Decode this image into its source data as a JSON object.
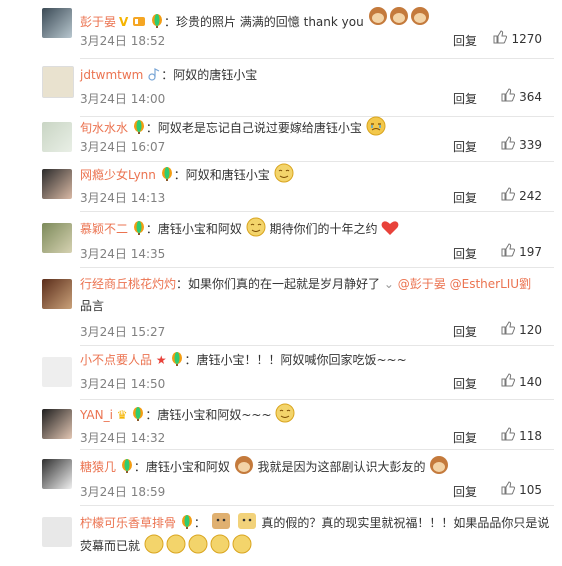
{
  "comments": [
    {
      "user": "彭于晏",
      "text": "珍贵的照片 满满的回憶 thank you",
      "date": "3月24日 18:52",
      "reply": "回复",
      "likes": "1270"
    },
    {
      "user": "jdtwmtwm",
      "text": "阿奴的唐钰小宝",
      "date": "3月24日 14:00",
      "reply": "回复",
      "likes": "364"
    },
    {
      "user": "旬水水水",
      "text": "阿奴老是忘记自己说过要嫁给唐钰小宝",
      "date": "3月24日 16:07",
      "reply": "回复",
      "likes": "339"
    },
    {
      "user": "网瘾少女Lynn",
      "text": "阿奴和唐钰小宝",
      "date": "3月24日 14:13",
      "reply": "回复",
      "likes": "242"
    },
    {
      "user": "慕颖不二",
      "text": "唐钰小宝和阿奴",
      "text2": "期待你们的十年之约",
      "date": "3月24日 14:35",
      "reply": "回复",
      "likes": "197"
    },
    {
      "user": "行经商丘桃花灼灼",
      "text": "如果你们真的在一起就是岁月静好了",
      "mention1": "@彭于晏",
      "mention2": "@EstherLIU劉",
      "line2": "品言",
      "date": "3月24日 15:27",
      "reply": "回复",
      "likes": "120"
    },
    {
      "user": "小不点要人品",
      "text": "唐钰小宝！！！阿奴喊你回家吃饭~~~",
      "date": "3月24日 14:50",
      "reply": "回复",
      "likes": "140"
    },
    {
      "user": "YAN_i",
      "text": "唐钰小宝和阿奴~~~",
      "date": "3月24日 14:32",
      "reply": "回复",
      "likes": "118"
    },
    {
      "user": "糖猿几",
      "text": "唐钰小宝和阿奴",
      "text2": "我就是因为这部剧认识大彭友的",
      "date": "3月24日 18:59",
      "reply": "回复",
      "likes": "105"
    },
    {
      "user": "柠檬可乐香草排骨",
      "text": "真的假的？真的现实里就祝福！！！如果品品你只是说",
      "line2": "荧幕而已就"
    }
  ],
  "colors": {
    "username": "#eb7350",
    "meta": "#808080",
    "divider": "#e6e6e6",
    "heart": "#e8423a",
    "emoji": "#f3c84b"
  }
}
